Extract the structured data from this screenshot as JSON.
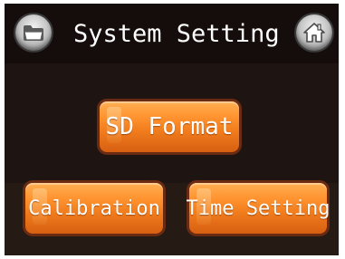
{
  "header": {
    "title": "System Setting",
    "left_icon": "folder-icon",
    "right_icon": "home-icon"
  },
  "buttons": {
    "sd_format": "SD Format",
    "calibration": "Calibration",
    "time_setting": "Time Setting"
  },
  "colors": {
    "background": "#1e1411",
    "button_orange": "#f07b1c",
    "button_border": "#6b2a12",
    "text": "#ffffff"
  }
}
